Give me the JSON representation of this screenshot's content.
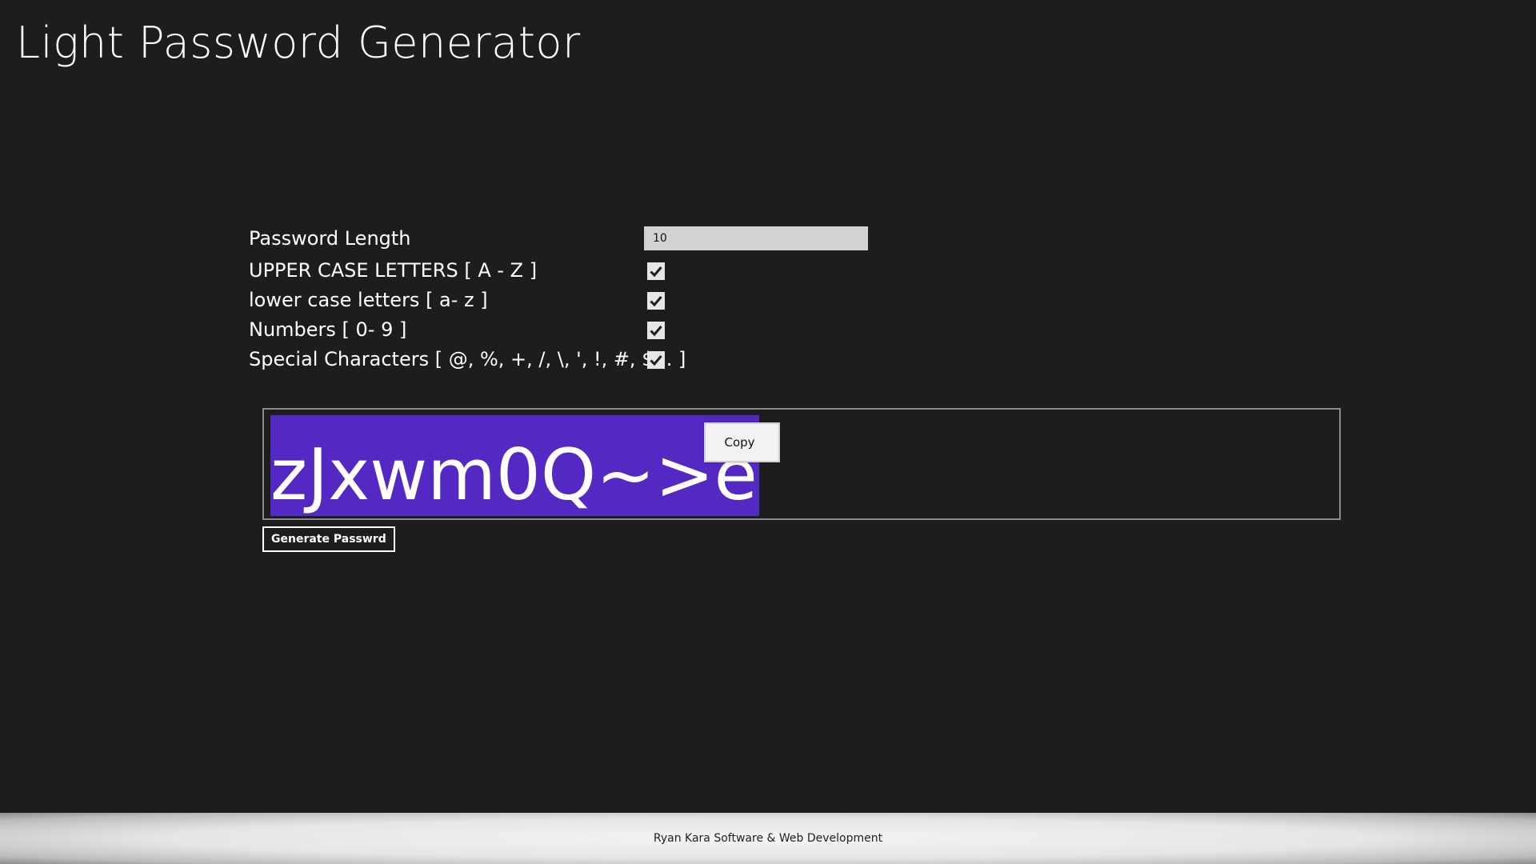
{
  "app": {
    "title": "Light Password Generator"
  },
  "options": {
    "length": {
      "label": "Password Length",
      "value": "10"
    },
    "uppercase": {
      "label": "UPPER CASE LETTERS [ A - Z ]",
      "checked": true
    },
    "lowercase": {
      "label": "lower case letters [ a- z ]",
      "checked": true
    },
    "numbers": {
      "label": "Numbers [ 0- 9 ]",
      "checked": true
    },
    "special": {
      "label": "Special Characters [ @, %, +, /, \\, ', !, #, $... ]",
      "checked": true
    }
  },
  "output": {
    "password": "zJxwm0Q~>e",
    "context_menu": {
      "copy_label": "Copy"
    },
    "selection_color": "#5428c2"
  },
  "actions": {
    "generate_label": "Generate Passwrd"
  },
  "footer": {
    "text": "Ryan Kara Software & Web Development"
  }
}
